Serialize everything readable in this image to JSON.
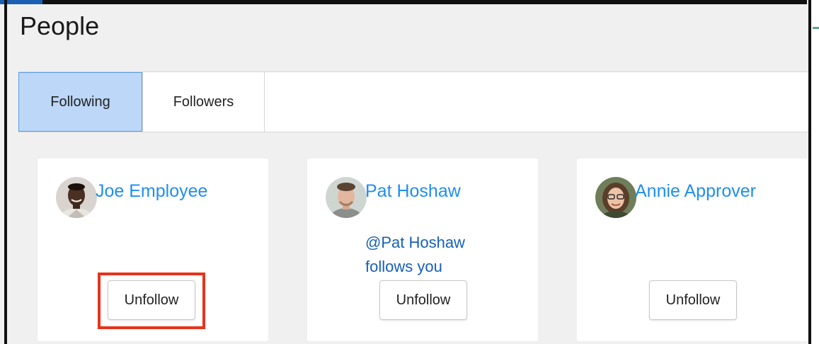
{
  "page": {
    "title": "People"
  },
  "tabs": [
    {
      "label": "Following",
      "active": true
    },
    {
      "label": "Followers",
      "active": false
    }
  ],
  "people": [
    {
      "name": "Joe Employee",
      "note_line1": "",
      "note_line2": "",
      "button": "Unfollow",
      "highlighted": true
    },
    {
      "name": "Pat Hoshaw",
      "note_line1": "@Pat Hoshaw",
      "note_line2": "follows you",
      "button": "Unfollow",
      "highlighted": false
    },
    {
      "name": "Annie Approver",
      "note_line1": "",
      "note_line2": "",
      "button": "Unfollow",
      "highlighted": false
    }
  ],
  "colors": {
    "link": "#1f8ef1",
    "note": "#1660b8",
    "active_tab": "#bcd7f7",
    "highlight": "#e8331c"
  }
}
